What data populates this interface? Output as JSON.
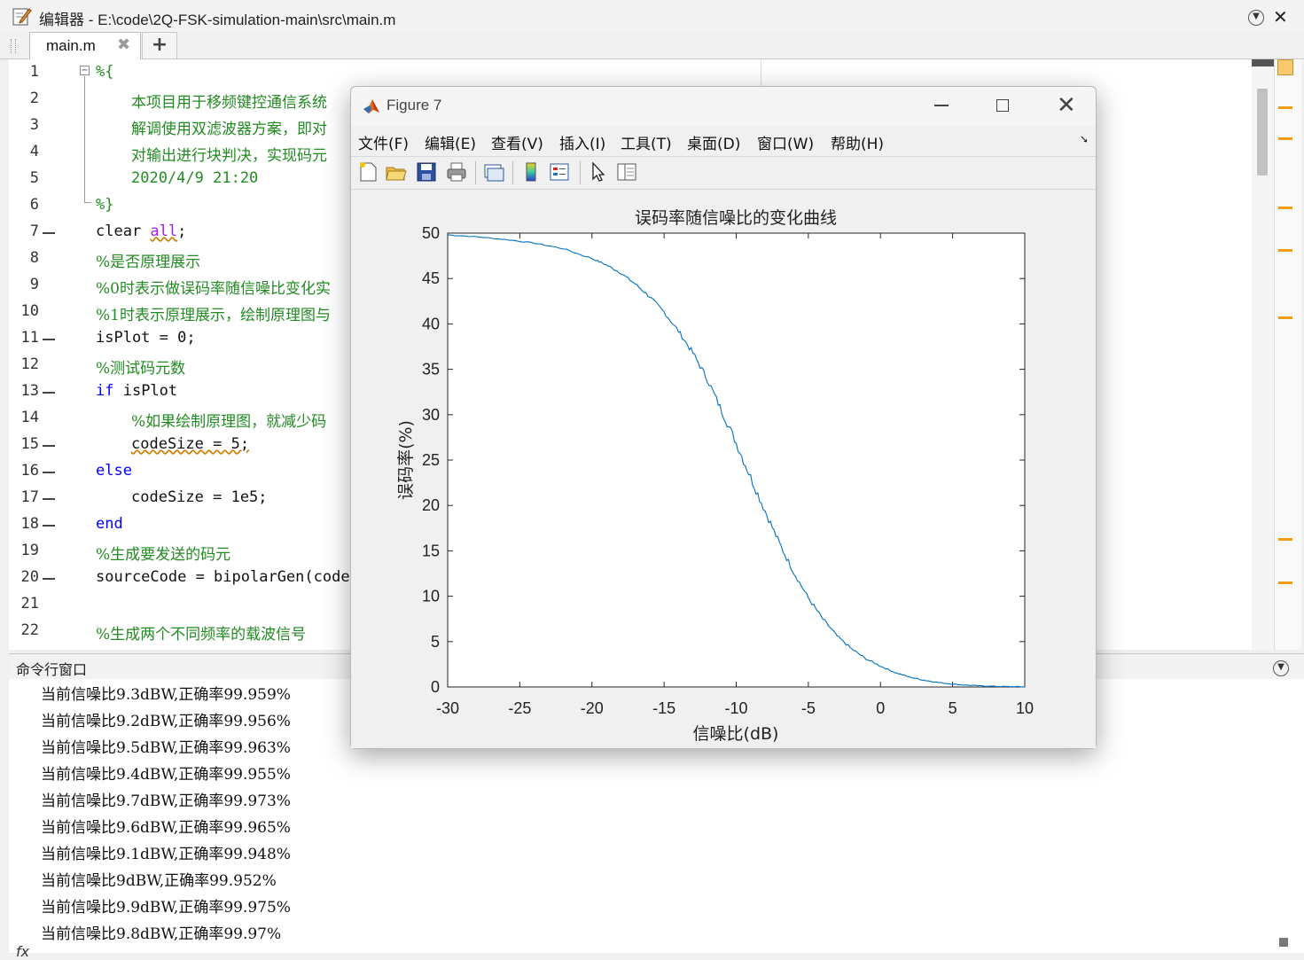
{
  "editor": {
    "title": "编辑器 - E:\\code\\2Q-FSK-simulation-main\\src\\main.m",
    "tab_label": "main.m",
    "tab_close": "✖",
    "tab_add": "+",
    "close": "✕"
  },
  "code": {
    "line_numbers": [
      "1",
      "2",
      "3",
      "4",
      "5",
      "6",
      "7",
      "8",
      "9",
      "10",
      "11",
      "12",
      "13",
      "14",
      "15",
      "16",
      "17",
      "18",
      "19",
      "20",
      "21",
      "22"
    ],
    "l1": "%{",
    "l2": "本项目用于移频键控通信系统",
    "l3": "解调使用双滤波器方案，即对",
    "l4": "对输出进行块判决，实现码元",
    "l5": "2020/4/9 21:20",
    "l6": "%}",
    "l7a": "clear ",
    "l7b": "all",
    "l7c": ";",
    "l8": "%是否原理展示",
    "l9": "%0时表示做误码率随信噪比变化实",
    "l10": "%1时表示原理展示，绘制原理图与",
    "l11": "isPlot = 0;",
    "l12": "%测试码元数",
    "l13a": "if",
    "l13b": " isPlot",
    "l14": "%如果绘制原理图，就减少码",
    "l15": "codeSize = 5;",
    "l16": "else",
    "l17": "codeSize = 1e5;",
    "l18": "end",
    "l19": "%生成要发送的码元",
    "l20": "sourceCode = bipolarGen(codeS",
    "l22": "%生成两个不同频率的载波信号"
  },
  "command_window": {
    "title": "命令行窗口",
    "prompt_icon": "fx",
    "lines": [
      "当前信噪比9.3dBW,正确率99.959%",
      "当前信噪比9.2dBW,正确率99.956%",
      "当前信噪比9.5dBW,正确率99.963%",
      "当前信噪比9.4dBW,正确率99.955%",
      "当前信噪比9.7dBW,正确率99.973%",
      "当前信噪比9.6dBW,正确率99.965%",
      "当前信噪比9.1dBW,正确率99.948%",
      "当前信噪比9dBW,正确率99.952%",
      "当前信噪比9.9dBW,正确率99.975%",
      "当前信噪比9.8dBW,正确率99.97%"
    ]
  },
  "figure": {
    "title": "Figure 7",
    "menus": [
      "文件(F)",
      "编辑(E)",
      "查看(V)",
      "插入(I)",
      "工具(T)",
      "桌面(D)",
      "窗口(W)",
      "帮助(H)"
    ]
  },
  "chart_data": {
    "type": "line",
    "title": "误码率随信噪比的变化曲线",
    "xlabel": "信噪比(dB)",
    "ylabel": "误码率(%)",
    "xlim": [
      -30,
      10
    ],
    "ylim": [
      0,
      50
    ],
    "xticks": [
      "-30",
      "-25",
      "-20",
      "-15",
      "-10",
      "-5",
      "0",
      "5",
      "10"
    ],
    "yticks": [
      "0",
      "5",
      "10",
      "15",
      "20",
      "25",
      "30",
      "35",
      "40",
      "45",
      "50"
    ],
    "grid": false,
    "color": "#0072bd",
    "x": [
      -30,
      -28,
      -26,
      -24,
      -22,
      -20,
      -19,
      -18,
      -17,
      -16,
      -15,
      -14,
      -13,
      -12,
      -11,
      -10,
      -9,
      -8,
      -7,
      -6,
      -5,
      -4,
      -3,
      -2,
      -1,
      0,
      1,
      2,
      3,
      4,
      5,
      6,
      7,
      8,
      9,
      10
    ],
    "y": [
      49.8,
      49.6,
      49.3,
      48.9,
      48.3,
      47.2,
      46.5,
      45.6,
      44.4,
      43.0,
      41.3,
      39.2,
      36.8,
      33.9,
      30.4,
      26.9,
      23.1,
      19.4,
      15.8,
      12.6,
      9.8,
      7.5,
      5.6,
      4.2,
      3.1,
      2.3,
      1.6,
      1.1,
      0.75,
      0.5,
      0.32,
      0.2,
      0.12,
      0.07,
      0.04,
      0.02
    ]
  }
}
